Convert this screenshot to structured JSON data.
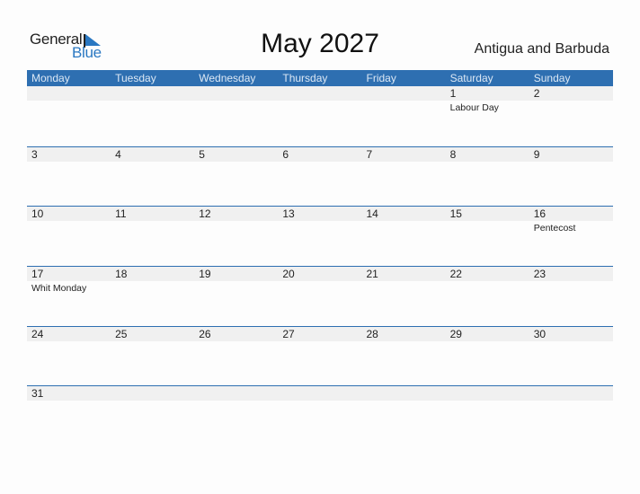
{
  "logo": {
    "word1": "General",
    "word2": "Blue"
  },
  "title": "May 2027",
  "country": "Antigua and Barbuda",
  "weekdays": [
    "Monday",
    "Tuesday",
    "Wednesday",
    "Thursday",
    "Friday",
    "Saturday",
    "Sunday"
  ],
  "weeks": [
    {
      "days": [
        "",
        "",
        "",
        "",
        "",
        "1",
        "2"
      ],
      "holidays": [
        "",
        "",
        "",
        "",
        "",
        "Labour Day",
        ""
      ]
    },
    {
      "days": [
        "3",
        "4",
        "5",
        "6",
        "7",
        "8",
        "9"
      ],
      "holidays": [
        "",
        "",
        "",
        "",
        "",
        "",
        ""
      ]
    },
    {
      "days": [
        "10",
        "11",
        "12",
        "13",
        "14",
        "15",
        "16"
      ],
      "holidays": [
        "",
        "",
        "",
        "",
        "",
        "",
        "Pentecost"
      ]
    },
    {
      "days": [
        "17",
        "18",
        "19",
        "20",
        "21",
        "22",
        "23"
      ],
      "holidays": [
        "Whit Monday",
        "",
        "",
        "",
        "",
        "",
        ""
      ]
    },
    {
      "days": [
        "24",
        "25",
        "26",
        "27",
        "28",
        "29",
        "30"
      ],
      "holidays": [
        "",
        "",
        "",
        "",
        "",
        "",
        ""
      ]
    },
    {
      "days": [
        "31",
        "",
        "",
        "",
        "",
        "",
        ""
      ],
      "holidays": [
        "",
        "",
        "",
        "",
        "",
        "",
        ""
      ]
    }
  ],
  "colors": {
    "accent": "#2e6fb1",
    "logo_blue": "#2a78c2",
    "band": "#f0f0f0"
  }
}
